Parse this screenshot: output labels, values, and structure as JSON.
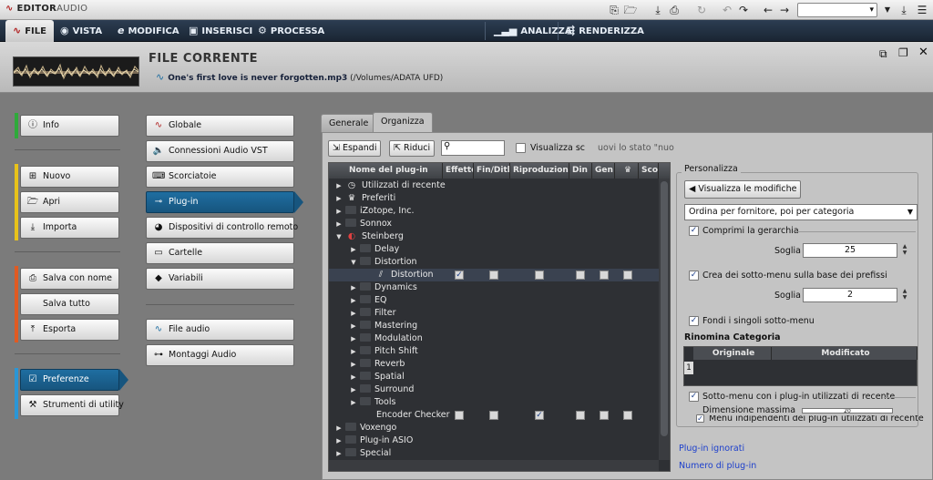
{
  "app": {
    "title_main": "EDITOR",
    "title_accent": "AUDIO"
  },
  "toolbar": {
    "combo_value": "▾"
  },
  "menubar": {
    "tabs": [
      {
        "label": "FILE",
        "icon": "wave-logo-icon"
      },
      {
        "label": "VISTA",
        "icon": "eye-icon"
      },
      {
        "label": "MODIFICA",
        "icon": "edit-icon"
      },
      {
        "label": "INSERISCI",
        "icon": "insert-icon"
      },
      {
        "label": "PROCESSA",
        "icon": "gears-icon"
      },
      {
        "label": "ANALIZZA",
        "icon": "bars-icon"
      },
      {
        "label": "RENDERIZZA",
        "icon": "render-icon"
      }
    ]
  },
  "file": {
    "header": "FILE CORRENTE",
    "name": "One's first love is never forgotten.mp3",
    "path": " (/Volumes/ADATA UFD)"
  },
  "left_nav": {
    "info": "Info",
    "nuovo": "Nuovo",
    "apri": "Apri",
    "importa": "Importa",
    "salva_con_nome": "Salva con nome",
    "salva_tutto": "Salva tutto",
    "esporta": "Esporta",
    "preferenze": "Preferenze",
    "strumenti": "Strumenti di utility"
  },
  "mid_nav": {
    "globale": "Globale",
    "connessioni": "Connessioni Audio VST",
    "scorciatoie": "Scorciatoie",
    "plugin": "Plug-in",
    "dispositivi": "Dispositivi di controllo remoto",
    "cartelle": "Cartelle",
    "variabili": "Variabili",
    "file_audio": "File audio",
    "montaggi": "Montaggi Audio"
  },
  "tabs": {
    "generale": "Generale",
    "organizza": "Organizza"
  },
  "panel": {
    "espandi": "Espandi",
    "riduci": "Riduci",
    "visualizza_label": "Visualizza sc",
    "hint": "uovi lo stato \"nuo"
  },
  "tree": {
    "headers": [
      "Nome del plug-in",
      "Effetto",
      "Fin/Dith",
      "Riproduzione",
      "Din",
      "Gen",
      "♛",
      "Scor"
    ],
    "rows": [
      {
        "label": "Utilizzati di recente",
        "indent": 0,
        "tri": "▶",
        "icon": "clock-icon",
        "checks": []
      },
      {
        "label": "Preferiti",
        "indent": 0,
        "tri": "▶",
        "icon": "crown-icon",
        "checks": []
      },
      {
        "label": "iZotope, Inc.",
        "indent": 0,
        "tri": "▶",
        "icon": "folder-icon",
        "checks": []
      },
      {
        "label": "Sonnox",
        "indent": 0,
        "tri": "▶",
        "icon": "folder-icon",
        "checks": []
      },
      {
        "label": "Steinberg",
        "indent": 0,
        "tri": "▼",
        "icon": "steinberg-icon",
        "checks": []
      },
      {
        "label": "Delay",
        "indent": 1,
        "tri": "▶",
        "icon": "folder-icon",
        "checks": []
      },
      {
        "label": "Distortion",
        "indent": 1,
        "tri": "▼",
        "icon": "folder-icon",
        "checks": []
      },
      {
        "label": "Distortion",
        "indent": 2,
        "tri": "",
        "icon": "plugin-icon",
        "checks": [
          true,
          false,
          false,
          false,
          false,
          false
        ]
      },
      {
        "label": "Dynamics",
        "indent": 1,
        "tri": "▶",
        "icon": "folder-icon",
        "checks": []
      },
      {
        "label": "EQ",
        "indent": 1,
        "tri": "▶",
        "icon": "folder-icon",
        "checks": []
      },
      {
        "label": "Filter",
        "indent": 1,
        "tri": "▶",
        "icon": "folder-icon",
        "checks": []
      },
      {
        "label": "Mastering",
        "indent": 1,
        "tri": "▶",
        "icon": "folder-icon",
        "checks": []
      },
      {
        "label": "Modulation",
        "indent": 1,
        "tri": "▶",
        "icon": "folder-icon",
        "checks": []
      },
      {
        "label": "Pitch Shift",
        "indent": 1,
        "tri": "▶",
        "icon": "folder-icon",
        "checks": []
      },
      {
        "label": "Reverb",
        "indent": 1,
        "tri": "▶",
        "icon": "folder-icon",
        "checks": []
      },
      {
        "label": "Spatial",
        "indent": 1,
        "tri": "▶",
        "icon": "folder-icon",
        "checks": []
      },
      {
        "label": "Surround",
        "indent": 1,
        "tri": "▶",
        "icon": "folder-icon",
        "checks": []
      },
      {
        "label": "Tools",
        "indent": 1,
        "tri": "▶",
        "icon": "folder-icon",
        "checks": []
      },
      {
        "label": "Encoder Checker",
        "indent": 1,
        "tri": "",
        "icon": "",
        "checks": [
          false,
          false,
          true,
          false,
          false,
          false
        ]
      },
      {
        "label": "Voxengo",
        "indent": 0,
        "tri": "▶",
        "icon": "folder-icon",
        "checks": []
      },
      {
        "label": "Plug-in ASIO",
        "indent": 0,
        "tri": "▶",
        "icon": "folder-icon",
        "checks": []
      },
      {
        "label": "Special",
        "indent": 0,
        "tri": "▶",
        "icon": "folder-icon",
        "checks": []
      }
    ]
  },
  "personalizza": {
    "title": "Personalizza",
    "visualizza_modifiche": "Visualizza le modifiche",
    "ordina": "Ordina per fornitore, poi per categoria",
    "comprimi": "Comprimi la gerarchia",
    "soglia1_label": "Soglia",
    "soglia1_value": "25",
    "crea_sottomenu": "Crea dei sotto-menu sulla base dei prefissi",
    "soglia2_label": "Soglia",
    "soglia2_value": "2",
    "fondi": "Fondi i singoli sotto-menu",
    "rinomina": "Rinomina Categoria",
    "col_originale": "Originale",
    "col_modificato": "Modificato",
    "row_num": "1",
    "sottomenu_recenti": "Sotto-menu con i plug-in utilizzati di recente",
    "dimensione_massima": "Dimensione massima",
    "dim_value": "20",
    "menu_indipendenti": "Menu indipendenti dei plug-in utilizzati di recente",
    "link_ignorati": "Plug-in ignorati",
    "link_numero": "Numero di plug-in"
  }
}
